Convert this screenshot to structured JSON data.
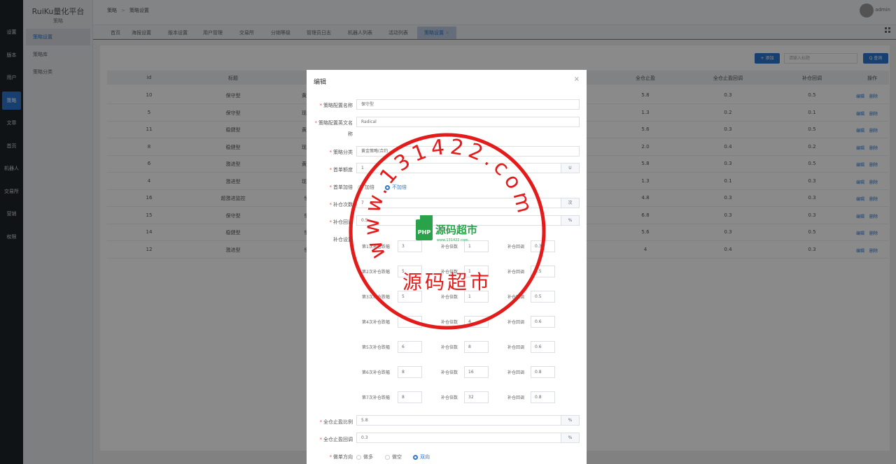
{
  "rail": [
    "设置",
    "版本",
    "用户",
    "策略",
    "文章",
    "首页",
    "机器人",
    "交易所",
    "营销",
    "权限"
  ],
  "brand": {
    "title": "RuiKu量化平台",
    "subtitle": "策略"
  },
  "submenu": [
    "策略设置",
    "策略库",
    "策略分类"
  ],
  "breadcrumb": [
    "策略",
    "策略设置"
  ],
  "user": {
    "name": "admin"
  },
  "tabs": [
    "首页",
    "海报设置",
    "版本设置",
    "用户管理",
    "交易所",
    "分销等级",
    "管理员日志",
    "机器人列表",
    "活动列表",
    "策略设置"
  ],
  "toolbar": {
    "add": "+ 添加",
    "search_placeholder": "请输入标题",
    "query": "Q 查询"
  },
  "table": {
    "headers": [
      "id",
      "标题",
      "全仓止盈",
      "全仓止盈回调",
      "补仓回调",
      "操作"
    ],
    "rows": [
      {
        "id": "10",
        "title": "保守型",
        "cat": "黄金",
        "tp": "5.8",
        "cb": "0.3",
        "rb": "0.5"
      },
      {
        "id": "5",
        "title": "保守型",
        "cat": "现货",
        "tp": "1.3",
        "cb": "0.2",
        "rb": "0.1"
      },
      {
        "id": "11",
        "title": "稳健型",
        "cat": "黄金",
        "tp": "5.6",
        "cb": "0.3",
        "rb": "0.5"
      },
      {
        "id": "8",
        "title": "稳健型",
        "cat": "现货",
        "tp": "2.0",
        "cb": "0.4",
        "rb": "0.2"
      },
      {
        "id": "6",
        "title": "激进型",
        "cat": "黄金",
        "tp": "5.8",
        "cb": "0.3",
        "rb": "0.5"
      },
      {
        "id": "4",
        "title": "激进型",
        "cat": "现货",
        "tp": "1.3",
        "cb": "0.1",
        "rb": "0.3"
      },
      {
        "id": "16",
        "title": "超激进监控",
        "cat": "恒",
        "tp": "4.8",
        "cb": "0.3",
        "rb": "0.3"
      },
      {
        "id": "15",
        "title": "保守型",
        "cat": "恒",
        "tp": "6.8",
        "cb": "0.3",
        "rb": "0.3"
      },
      {
        "id": "14",
        "title": "稳健型",
        "cat": "恒",
        "tp": "5.6",
        "cb": "0.3",
        "rb": "0.5"
      },
      {
        "id": "12",
        "title": "激进型",
        "cat": "恒",
        "tp": "4",
        "cb": "0.4",
        "rb": "0.3"
      }
    ],
    "edit": "编辑",
    "delete": "删除"
  },
  "modal": {
    "title": "编辑",
    "close": "×",
    "name_label": "策略配置名称",
    "name_value": "保守型",
    "en_label": "策略配置英文名",
    "en_label_wrap": "称",
    "en_value": "Radical",
    "cat_label": "策略分类",
    "cat_value": "黄金策略(合约",
    "first_label": "首单额度",
    "first_value": "1",
    "first_unit": "U",
    "double_label": "首单加倍",
    "double_yes": "加倍",
    "double_no": "不加倍",
    "count_label": "补仓次数",
    "count_value": "7",
    "count_unit": "次",
    "callback_label": "补仓回调",
    "callback_value": "0.5",
    "percent": "%",
    "settings_label": "补仓设置",
    "steps": [
      {
        "label": "第1次补仓跌幅",
        "drop": "3",
        "mult_label": "补仓倍数",
        "mult": "1",
        "cb_label": "补仓回调",
        "cb": "0.3"
      },
      {
        "label": "第2次补仓跌幅",
        "drop": "5",
        "mult_label": "补仓倍数",
        "mult": "1",
        "cb_label": "补仓回调",
        "cb": "0.5"
      },
      {
        "label": "第3次补仓跌幅",
        "drop": "5",
        "mult_label": "补仓倍数",
        "mult": "1",
        "cb_label": "补仓回调",
        "cb": "0.5"
      },
      {
        "label": "第4次补仓跌幅",
        "drop": "",
        "mult_label": "补仓倍数",
        "mult": "4",
        "cb_label": "补仓回调",
        "cb": "0.6"
      },
      {
        "label": "第5次补仓跌幅",
        "drop": "6",
        "mult_label": "补仓倍数",
        "mult": "8",
        "cb_label": "补仓回调",
        "cb": "0.6"
      },
      {
        "label": "第6次补仓跌幅",
        "drop": "8",
        "mult_label": "补仓倍数",
        "mult": "16",
        "cb_label": "补仓回调",
        "cb": "0.8"
      },
      {
        "label": "第7次补仓跌幅",
        "drop": "8",
        "mult_label": "补仓倍数",
        "mult": "32",
        "cb_label": "补仓回调",
        "cb": "0.8"
      }
    ],
    "tp_ratio_label": "全仓止盈比例",
    "tp_ratio_value": "5.8",
    "tp_cb_label": "全仓止盈回调",
    "tp_cb_value": "0.3",
    "dir_label": "做单方向",
    "dir_long": "做多",
    "dir_short": "做空",
    "dir_both": "双向"
  },
  "watermark": {
    "arc": "www.131422.com",
    "logo": "源码超市",
    "logo_sub": "www.131422.com",
    "text": "源码超市",
    "badge": "PHP",
    "color": "#e31b1b"
  }
}
